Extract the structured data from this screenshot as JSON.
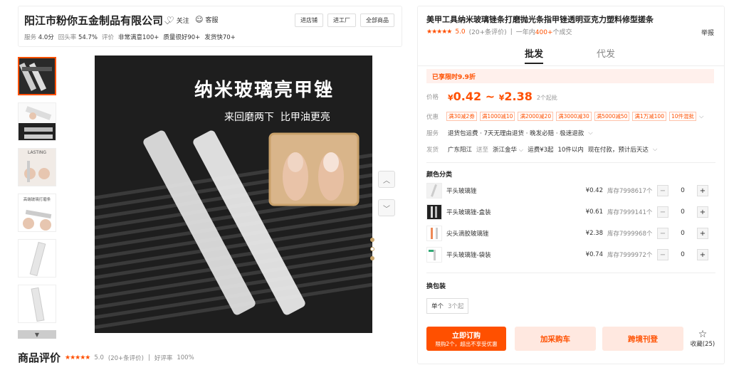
{
  "shop": {
    "name": "阳江市粉你五金制品有限公司",
    "follow": "关注",
    "service": "客服",
    "buttons": [
      "进店铺",
      "进工厂",
      "全部商品"
    ],
    "stats": {
      "service_label": "服务",
      "service_val": "4.0分",
      "repeat_label": "回头率",
      "repeat_val": "54.7%",
      "review_label": "评价",
      "tag1": "非常满意100+",
      "tag2": "质量很好90+",
      "tag3": "发货快70+"
    }
  },
  "gallery": {
    "main_title": "纳米玻璃亮甲锉",
    "main_sub": "来回磨两下  比甲油更亮",
    "thumb_text": "LASTING",
    "thumb_text2": "高端玻璃打磨条",
    "dots": 3,
    "active_dot": 0
  },
  "reviews": {
    "title": "商品评价",
    "stars": "★★★★★",
    "score": "5.0",
    "count": "(20+条评价)",
    "sep": "|",
    "good_label": "好评率",
    "good_val": "100%"
  },
  "product": {
    "title": "美甲工具纳米玻璃锉条打磨抛光条指甲锉透明亚克力塑料修型搓条",
    "stars": "★★★★★",
    "score": "5.0",
    "reviews": "(20+条评价)",
    "sep": "|",
    "sales_prefix": "一年内",
    "sales_num": "400+",
    "sales_suffix": "个成交",
    "report": "举报",
    "tabs": [
      "批发",
      "代发"
    ],
    "promo": "已享限时9.9折",
    "price_label": "价格",
    "price_low": "0.42",
    "price_tilde": "~",
    "price_high": "2.38",
    "currency": "¥",
    "moq": "2个起批",
    "coupon_label": "优惠",
    "coupons": [
      "满30减2券",
      "满1000减10",
      "满2000减20",
      "满3000减30",
      "满5000减50",
      "满1万减100",
      "10件混批"
    ],
    "svc_label": "服务",
    "svc_text": "退货包运费 · 7天无理由退货 · 晚发必赔 · 极速退款",
    "ship_label": "发货",
    "ship_from": "广东阳江",
    "ship_to_word": "送至",
    "ship_to": "浙江金华",
    "ship_fee": "运费¥3起",
    "ship_qty": "10件以内",
    "ship_time": "现在付款，预计后天达",
    "sku_title": "颜色分类",
    "skus": [
      {
        "name": "平头玻璃锉",
        "price": "¥0.42",
        "stock": "库存7998617个",
        "qty": "0"
      },
      {
        "name": "平头玻璃锉-盒装",
        "price": "¥0.61",
        "stock": "库存7999141个",
        "qty": "0"
      },
      {
        "name": "尖头滴胶玻璃锉",
        "price": "¥2.38",
        "stock": "库存7999968个",
        "qty": "0"
      },
      {
        "name": "平头玻璃锉-袋装",
        "price": "¥0.74",
        "stock": "库存7999972个",
        "qty": "0"
      }
    ],
    "pack_title": "换包装",
    "pack_name": "单个",
    "pack_moq": "3个起",
    "order_l1": "立即订购",
    "order_l2": "限购2个，超出不享受优惠",
    "cart": "加采购车",
    "cross": "跨境刊登",
    "fav": "收藏(25)"
  },
  "colors": {
    "accent": "#ff5000",
    "promo_bg": "#fff0ec",
    "btn_light": "#ffe8e0"
  }
}
